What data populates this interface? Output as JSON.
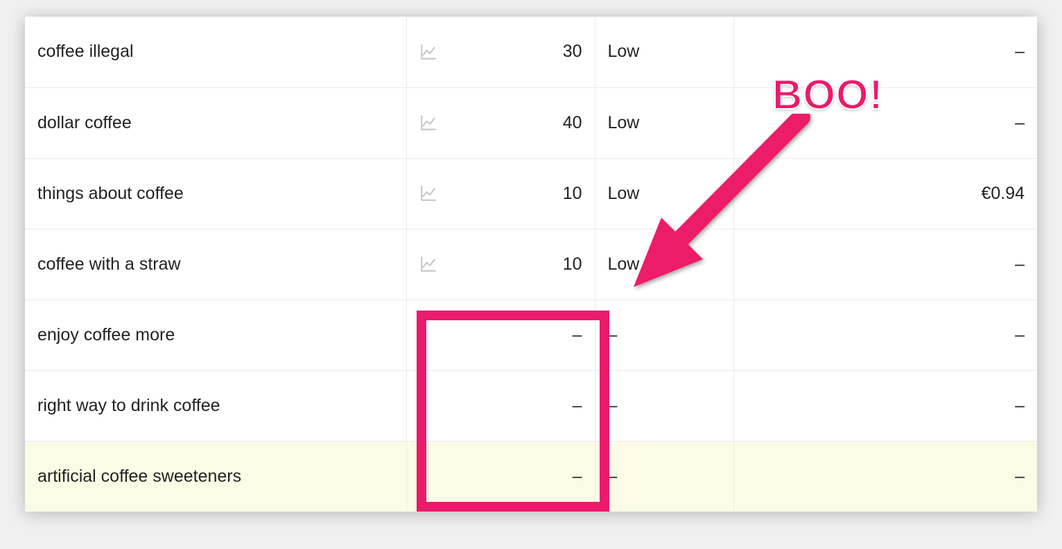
{
  "annotation": {
    "text": "BOO!"
  },
  "rows": [
    {
      "keyword": "coffee illegal",
      "has_chart": true,
      "volume": "30",
      "competition": "Low",
      "bid": "–",
      "highlight": false
    },
    {
      "keyword": "dollar coffee",
      "has_chart": true,
      "volume": "40",
      "competition": "Low",
      "bid": "–",
      "highlight": false
    },
    {
      "keyword": "things about coffee",
      "has_chart": true,
      "volume": "10",
      "competition": "Low",
      "bid": "€0.94",
      "highlight": false
    },
    {
      "keyword": "coffee with a straw",
      "has_chart": true,
      "volume": "10",
      "competition": "Low",
      "bid": "–",
      "highlight": false
    },
    {
      "keyword": "enjoy coffee more",
      "has_chart": false,
      "volume": "–",
      "competition": "–",
      "bid": "–",
      "highlight": false
    },
    {
      "keyword": "right way to drink coffee",
      "has_chart": false,
      "volume": "–",
      "competition": "–",
      "bid": "–",
      "highlight": false
    },
    {
      "keyword": "artificial coffee sweeteners",
      "has_chart": false,
      "volume": "–",
      "competition": "–",
      "bid": "–",
      "highlight": true
    }
  ]
}
